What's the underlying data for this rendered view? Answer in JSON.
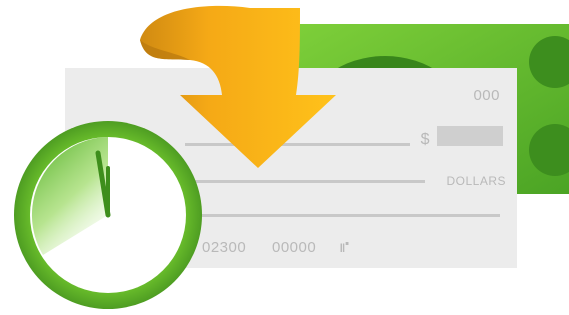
{
  "check": {
    "number": "000",
    "currency_symbol": "$",
    "dollars_label": "DOLLARS",
    "routing_number": "02300",
    "account_number": "00000",
    "micr_symbol": "⑈"
  },
  "icons": {
    "bill": "dollar-bill-icon",
    "arrow": "deposit-arrow-icon",
    "check": "paper-check-icon",
    "timer": "stopwatch-icon"
  },
  "colors": {
    "bill_green": "#5cb82a",
    "arrow_yellow": "#ffbe15",
    "check_gray": "#ececec",
    "timer_green": "#6cc02c"
  }
}
